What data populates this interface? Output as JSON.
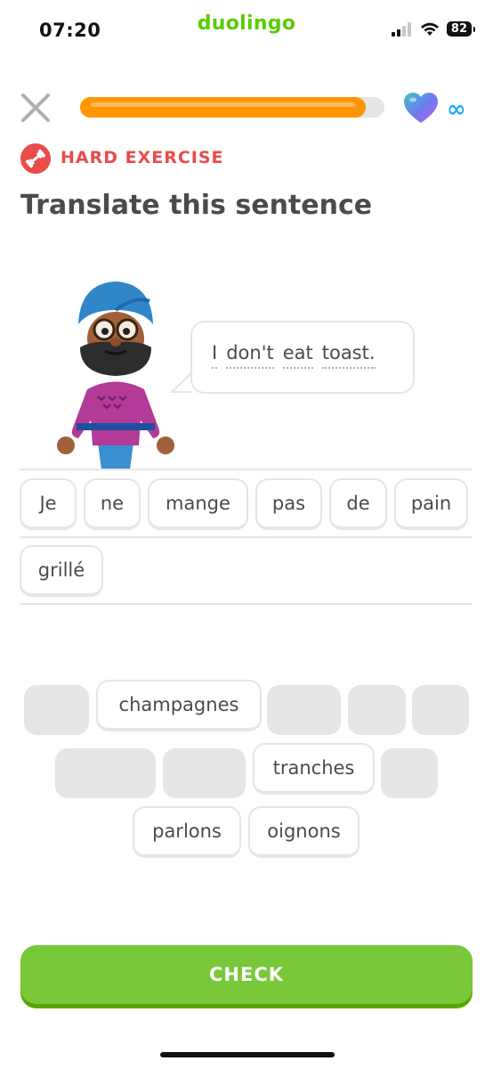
{
  "status_bar": {
    "time": "07:20",
    "brand": "duolingo",
    "battery": "82",
    "icons": [
      "signal-icon",
      "wifi-icon",
      "battery-icon"
    ]
  },
  "header": {
    "progress": 0.94,
    "lives": "∞",
    "colors": {
      "progress": "#ff9600",
      "track": "#e5e5e5",
      "infinity": "#1cb0f6"
    }
  },
  "exercise": {
    "label": "HARD EXERCISE",
    "title": "Translate this sentence",
    "colors": {
      "label": "#ea4b4b"
    }
  },
  "prompt": {
    "words": [
      "I",
      "don't",
      "eat",
      "toast."
    ]
  },
  "answer": {
    "tiles": [
      "Je",
      "ne",
      "mange",
      "pas",
      "de",
      "pain",
      "grillé"
    ]
  },
  "word_bank": {
    "visible": [
      "champagnes",
      "tranches",
      "parlons",
      "oignons"
    ]
  },
  "check_button": {
    "label": "CHECK",
    "color": "#78c83a"
  }
}
